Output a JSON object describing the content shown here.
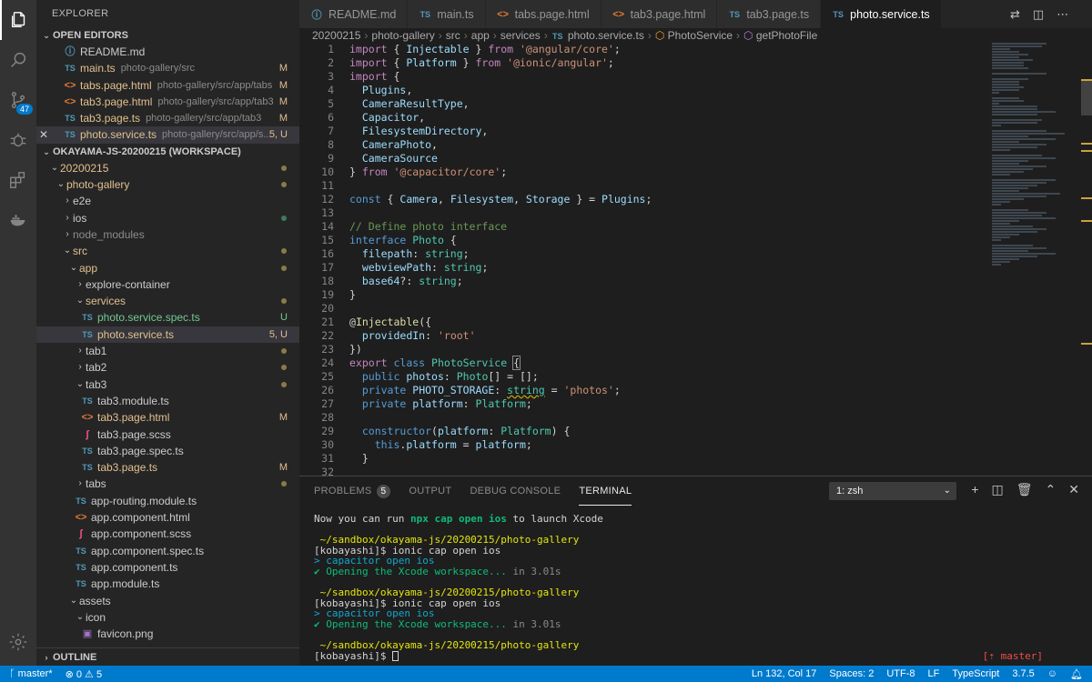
{
  "activity_bar": {
    "scm_badge": "47"
  },
  "sidebar": {
    "title": "EXPLORER",
    "open_editors_label": "OPEN EDITORS",
    "open_editors": [
      {
        "icon": "info",
        "name": "README.md",
        "desc": "",
        "status": "",
        "cls": "",
        "close": false
      },
      {
        "icon": "TS",
        "name": "main.ts",
        "desc": "photo-gallery/src",
        "status": "M",
        "cls": "mod",
        "close": false
      },
      {
        "icon": "<>",
        "name": "tabs.page.html",
        "desc": "photo-gallery/src/app/tabs",
        "status": "M",
        "cls": "mod",
        "close": false
      },
      {
        "icon": "<>",
        "name": "tab3.page.html",
        "desc": "photo-gallery/src/app/tab3",
        "status": "M",
        "cls": "mod",
        "close": false
      },
      {
        "icon": "TS",
        "name": "tab3.page.ts",
        "desc": "photo-gallery/src/app/tab3",
        "status": "M",
        "cls": "mod",
        "close": false
      },
      {
        "icon": "TS",
        "name": "photo.service.ts",
        "desc": "photo-gallery/src/app/s...",
        "status": "5, U",
        "cls": "mod",
        "close": true
      }
    ],
    "workspace_label": "OKAYAMA-JS-20200215 (WORKSPACE)",
    "tree": [
      {
        "indent": 0,
        "tw": "⌄",
        "icon": "",
        "name": "20200215",
        "cls": "ylw",
        "mark": "dot-y"
      },
      {
        "indent": 1,
        "tw": "⌄",
        "icon": "",
        "name": "photo-gallery",
        "cls": "ylw",
        "mark": "dot-y"
      },
      {
        "indent": 2,
        "tw": "›",
        "icon": "",
        "name": "e2e",
        "cls": "",
        "mark": ""
      },
      {
        "indent": 2,
        "tw": "›",
        "icon": "",
        "name": "ios",
        "cls": "",
        "mark": "dot-g"
      },
      {
        "indent": 2,
        "tw": "›",
        "icon": "",
        "name": "node_modules",
        "cls": "grey",
        "mark": ""
      },
      {
        "indent": 2,
        "tw": "⌄",
        "icon": "",
        "name": "src",
        "cls": "ylw",
        "mark": "dot-y"
      },
      {
        "indent": 3,
        "tw": "⌄",
        "icon": "",
        "name": "app",
        "cls": "ylw",
        "mark": "dot-y"
      },
      {
        "indent": 4,
        "tw": "›",
        "icon": "",
        "name": "explore-container",
        "cls": "",
        "mark": ""
      },
      {
        "indent": 4,
        "tw": "⌄",
        "icon": "",
        "name": "services",
        "cls": "ylw",
        "mark": "dot-y"
      },
      {
        "indent": 5,
        "tw": "",
        "icon": "TS",
        "name": "photo.service.spec.ts",
        "cls": "untr",
        "mark": "U"
      },
      {
        "indent": 5,
        "tw": "",
        "icon": "TS",
        "name": "photo.service.ts",
        "cls": "mod",
        "mark": "5, U",
        "sel": true
      },
      {
        "indent": 4,
        "tw": "›",
        "icon": "",
        "name": "tab1",
        "cls": "",
        "mark": "dot-y"
      },
      {
        "indent": 4,
        "tw": "›",
        "icon": "",
        "name": "tab2",
        "cls": "",
        "mark": "dot-y"
      },
      {
        "indent": 4,
        "tw": "⌄",
        "icon": "",
        "name": "tab3",
        "cls": "",
        "mark": "dot-y"
      },
      {
        "indent": 5,
        "tw": "",
        "icon": "TS",
        "name": "tab3.module.ts",
        "cls": "",
        "mark": ""
      },
      {
        "indent": 5,
        "tw": "",
        "icon": "<>",
        "name": "tab3.page.html",
        "cls": "mod",
        "mark": "M"
      },
      {
        "indent": 5,
        "tw": "",
        "icon": "scss",
        "name": "tab3.page.scss",
        "cls": "",
        "mark": ""
      },
      {
        "indent": 5,
        "tw": "",
        "icon": "TS",
        "name": "tab3.page.spec.ts",
        "cls": "",
        "mark": ""
      },
      {
        "indent": 5,
        "tw": "",
        "icon": "TS",
        "name": "tab3.page.ts",
        "cls": "mod",
        "mark": "M"
      },
      {
        "indent": 4,
        "tw": "›",
        "icon": "",
        "name": "tabs",
        "cls": "",
        "mark": "dot-y"
      },
      {
        "indent": 4,
        "tw": "",
        "icon": "TS",
        "name": "app-routing.module.ts",
        "cls": "",
        "mark": ""
      },
      {
        "indent": 4,
        "tw": "",
        "icon": "<>",
        "name": "app.component.html",
        "cls": "",
        "mark": ""
      },
      {
        "indent": 4,
        "tw": "",
        "icon": "scss",
        "name": "app.component.scss",
        "cls": "",
        "mark": ""
      },
      {
        "indent": 4,
        "tw": "",
        "icon": "TS",
        "name": "app.component.spec.ts",
        "cls": "",
        "mark": ""
      },
      {
        "indent": 4,
        "tw": "",
        "icon": "TS",
        "name": "app.component.ts",
        "cls": "",
        "mark": ""
      },
      {
        "indent": 4,
        "tw": "",
        "icon": "TS",
        "name": "app.module.ts",
        "cls": "",
        "mark": ""
      },
      {
        "indent": 3,
        "tw": "⌄",
        "icon": "",
        "name": "assets",
        "cls": "",
        "mark": ""
      },
      {
        "indent": 4,
        "tw": "⌄",
        "icon": "",
        "name": "icon",
        "cls": "",
        "mark": ""
      },
      {
        "indent": 5,
        "tw": "",
        "icon": "png",
        "name": "favicon.png",
        "cls": "",
        "mark": ""
      }
    ],
    "outline_label": "OUTLINE"
  },
  "tabs": [
    {
      "icon": "info",
      "label": "README.md",
      "active": false
    },
    {
      "icon": "TS",
      "label": "main.ts",
      "active": false
    },
    {
      "icon": "<>",
      "label": "tabs.page.html",
      "active": false
    },
    {
      "icon": "<>",
      "label": "tab3.page.html",
      "active": false
    },
    {
      "icon": "TS",
      "label": "tab3.page.ts",
      "active": false
    },
    {
      "icon": "TS",
      "label": "photo.service.ts",
      "active": true
    }
  ],
  "breadcrumb": [
    "20200215",
    "photo-gallery",
    "src",
    "app",
    "services",
    "photo.service.ts",
    "PhotoService",
    "getPhotoFile"
  ],
  "editor": {
    "line_numbers": [
      "1",
      "2",
      "3",
      "4",
      "5",
      "6",
      "7",
      "8",
      "9",
      "10",
      "11",
      "12",
      "13",
      "14",
      "15",
      "16",
      "17",
      "18",
      "19",
      "20",
      "21",
      "22",
      "23",
      "24",
      "25",
      "26",
      "27",
      "28",
      "29",
      "30",
      "31",
      "32"
    ]
  },
  "panel": {
    "tabs": [
      {
        "label": "PROBLEMS",
        "count": "5",
        "active": false
      },
      {
        "label": "OUTPUT",
        "count": "",
        "active": false
      },
      {
        "label": "DEBUG CONSOLE",
        "count": "",
        "active": false
      },
      {
        "label": "TERMINAL",
        "count": "",
        "active": true
      }
    ],
    "terminal_select": "1: zsh",
    "terminal": {
      "l1a": "Now you can run ",
      "l1b": "npx cap open ios",
      "l1c": " to launch Xcode",
      "path": " ~/sandbox/okayama-js/20200215/photo-gallery",
      "prompt": "[kobayashi]$ ionic cap open ios",
      "cap": "> capacitor open ios",
      "opening": "✔ Opening the Xcode workspace...",
      "time": " in 3.01s",
      "last_prompt": "[kobayashi]$ ",
      "branch": "[⇡ master]"
    }
  },
  "status": {
    "branch": "master*",
    "errors": "0",
    "warnings": "5",
    "position": "Ln 132, Col 17",
    "spaces": "Spaces: 2",
    "encoding": "UTF-8",
    "eol": "LF",
    "language": "TypeScript",
    "version": "3.7.5"
  }
}
